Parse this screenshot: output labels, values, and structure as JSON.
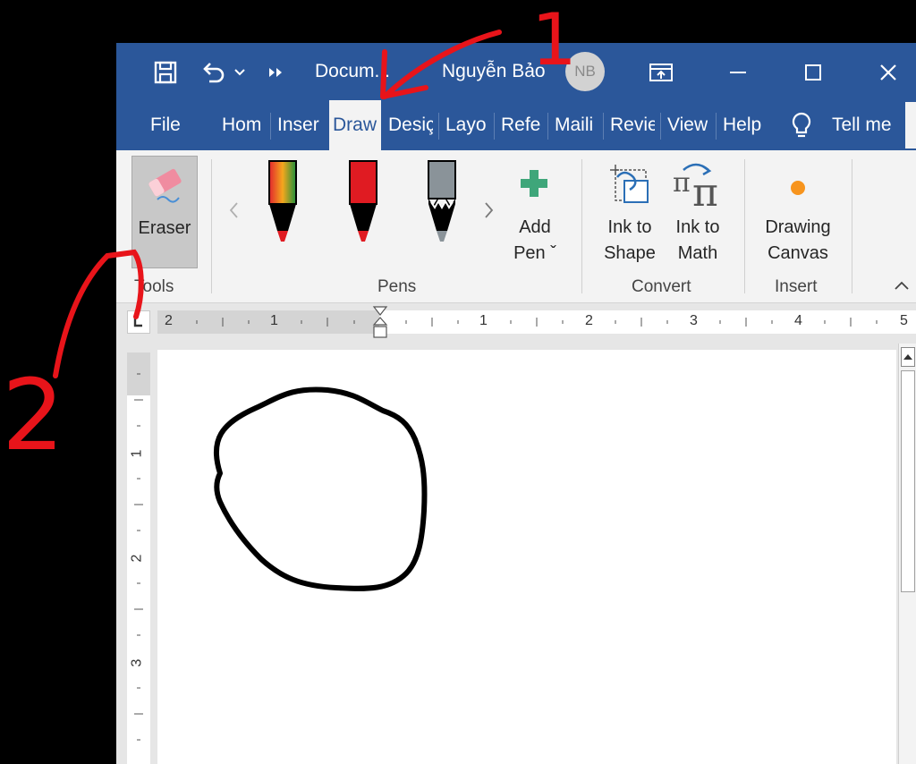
{
  "title_bar": {
    "document_title": "Docum...",
    "user_name": "Nguyễn Bảo",
    "user_initials": "NB",
    "icons": [
      "save-icon",
      "undo-icon",
      "more-commands-icon",
      "ribbon-display-icon",
      "minimize-icon",
      "maximize-icon",
      "close-icon"
    ]
  },
  "tabs": [
    {
      "label": "File"
    },
    {
      "label": "Hom"
    },
    {
      "label": "Inser"
    },
    {
      "label": "Draw",
      "active": true
    },
    {
      "label": "Desiç"
    },
    {
      "label": "Layo"
    },
    {
      "label": "Refe"
    },
    {
      "label": "Maili"
    },
    {
      "label": "Revie"
    },
    {
      "label": "View"
    },
    {
      "label": "Help"
    }
  ],
  "tell_me": "Tell me",
  "ribbon": {
    "eraser_label": "Eraser",
    "tools_label": "Tools",
    "pens_label": "Pens",
    "pens": [
      {
        "name": "rainbow-pen",
        "colors": [
          "#e2262d",
          "#f4a71d",
          "#1e8f3b"
        ]
      },
      {
        "name": "red-pen",
        "color": "#e01b22"
      },
      {
        "name": "galaxy-pencil",
        "color": "#8a9399"
      }
    ],
    "add_pen_line1": "Add",
    "add_pen_line2": "Pen ˇ",
    "ink_to_shape_line1": "Ink to",
    "ink_to_shape_line2": "Shape",
    "ink_to_math_line1": "Ink to",
    "ink_to_math_line2": "Math",
    "convert_label": "Convert",
    "drawing_canvas_line1": "Drawing",
    "drawing_canvas_line2": "Canvas",
    "insert_label": "Insert"
  },
  "ruler": {
    "horizontal_numbers": [
      "2",
      "1",
      "1",
      "2",
      "3",
      "4",
      "5"
    ],
    "vertical_numbers": [
      "1",
      "2",
      "3"
    ]
  },
  "annotations": {
    "label_1": "1",
    "label_2": "2"
  },
  "colors": {
    "accent": "#2b579a",
    "annotation_red": "#e8141a",
    "ribbon_bg": "#f3f3f3"
  }
}
